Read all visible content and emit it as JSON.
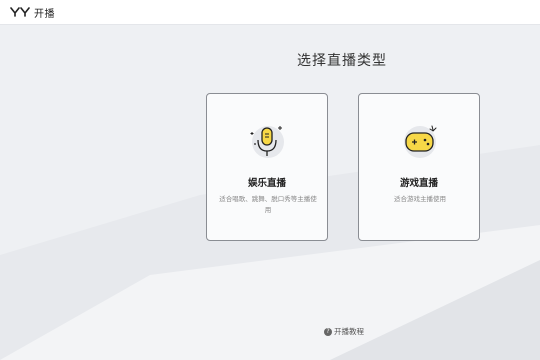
{
  "app": {
    "logo_text": "开播"
  },
  "page": {
    "heading": "选择直播类型"
  },
  "cards": [
    {
      "title": "娱乐直播",
      "description": "适合唱歌、跳舞、脱口秀等主播使用",
      "icon": "microphone-icon"
    },
    {
      "title": "游戏直播",
      "description": "适合游戏主播使用",
      "icon": "gamepad-icon"
    }
  ],
  "footer": {
    "tutorial_label": "开播教程",
    "tutorial_icon": "question-icon"
  },
  "colors": {
    "accent_yellow": "#F7D847",
    "icon_bg": "#E6E8EC",
    "card_border": "#8A8D93"
  }
}
